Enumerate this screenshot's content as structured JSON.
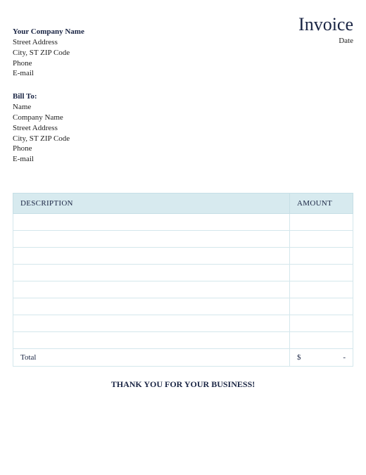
{
  "header": {
    "title": "Invoice",
    "date_label": "Date"
  },
  "company": {
    "name_label": "Your Company Name",
    "street": "Street Address",
    "city_line": "City, ST  ZIP Code",
    "phone": "Phone",
    "email": "E-mail"
  },
  "bill_to": {
    "label": "Bill To:",
    "name": "Name",
    "company": "Company Name",
    "street": "Street Address",
    "city_line": "City, ST  ZIP Code",
    "phone": "Phone",
    "email": "E-mail"
  },
  "table": {
    "description_header": "DESCRIPTION",
    "amount_header": "AMOUNT",
    "rows": [
      {
        "description": "",
        "amount": ""
      },
      {
        "description": "",
        "amount": ""
      },
      {
        "description": "",
        "amount": ""
      },
      {
        "description": "",
        "amount": ""
      },
      {
        "description": "",
        "amount": ""
      },
      {
        "description": "",
        "amount": ""
      },
      {
        "description": "",
        "amount": ""
      },
      {
        "description": "",
        "amount": ""
      }
    ],
    "total_label": "Total",
    "total_currency": "$",
    "total_value": "-"
  },
  "footer": {
    "thanks": "THANK YOU FOR YOUR BUSINESS!"
  }
}
